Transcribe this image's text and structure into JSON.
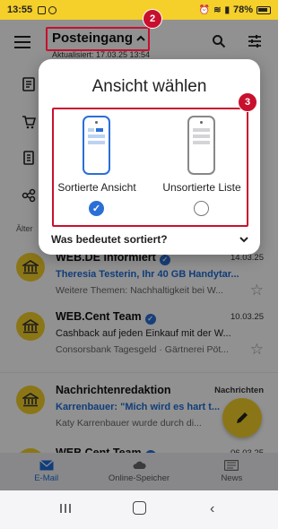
{
  "status_bar": {
    "time": "13:55",
    "battery": "78%"
  },
  "app_bar": {
    "folder_title": "Posteingang",
    "subtitle": "Aktualisiert: 17.03.25 13:54"
  },
  "badges": {
    "badge_folder": "2",
    "badge_options": "3"
  },
  "list": {
    "section_label": "Älter"
  },
  "mails": [
    {
      "sender": "WEB.DE Informiert",
      "date": "14.03.25",
      "subject": "Theresia Testerin, Ihr 40 GB Handytar...",
      "subject_unread": true,
      "preview": "Weitere Themen: Nachhaltigkeit bei W..."
    },
    {
      "sender": "WEB.Cent Team",
      "date": "10.03.25",
      "subject": "Cashback auf jeden Einkauf mit der W...",
      "subject_unread": false,
      "preview": "Consorsbank Tagesgeld · Gärtnerei Pöt..."
    },
    {
      "sender": "Nachrichtenredaktion",
      "date": "Nachrichten",
      "subject": "Karrenbauer: \"Mich wird es hart t...",
      "subject_unread": true,
      "preview": "Katy Karrenbauer wurde durch di..."
    },
    {
      "sender": "WEB.Cent Team",
      "date": "06.03.25",
      "subject": "",
      "subject_unread": false,
      "preview": ""
    }
  ],
  "dialog": {
    "title": "Ansicht wählen",
    "options": [
      {
        "label": "Sortierte Ansicht",
        "selected": true
      },
      {
        "label": "Unsortierte Liste",
        "selected": false
      }
    ],
    "info_label": "Was bedeutet sortiert?"
  },
  "bottom_nav": {
    "items": [
      {
        "label": "E-Mail",
        "icon": "mail-icon",
        "active": true
      },
      {
        "label": "Online-Speicher",
        "icon": "cloud-icon",
        "active": false
      },
      {
        "label": "News",
        "icon": "news-icon",
        "active": false
      }
    ]
  },
  "colors": {
    "brand_yellow": "#f5cf2a",
    "accent_blue": "#2b6fd6",
    "annotation_red": "#c8102e"
  }
}
